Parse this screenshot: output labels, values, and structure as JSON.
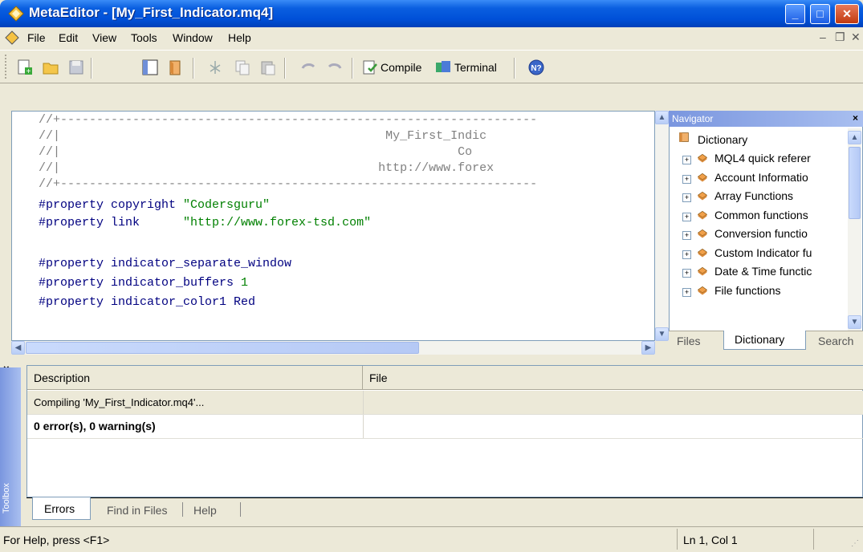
{
  "window": {
    "title": "MetaEditor - [My_First_Indicator.mq4]"
  },
  "menu": {
    "file": "File",
    "edit": "Edit",
    "view": "View",
    "tools": "Tools",
    "window": "Window",
    "help": "Help"
  },
  "toolbar": {
    "compile_label": "Compile",
    "terminal_label": "Terminal"
  },
  "editor": {
    "lines": [
      "//+------------------------------------------------------------------",
      "//|                                             My_First_Indic",
      "//|                                                       Co",
      "//|                                            http://www.forex",
      "//+------------------------------------------------------------------"
    ],
    "prop1_kw": "#property copyright ",
    "prop1_val": "\"Codersguru\"",
    "prop2_kw": "#property link      ",
    "prop2_val": "\"http://www.forex-tsd.com\"",
    "prop3": "#property indicator_separate_window",
    "prop4_kw": "#property indicator_buffers ",
    "prop4_val": "1",
    "prop5_kw": "#property indicator_color1 ",
    "prop5_val": "Red"
  },
  "navigator": {
    "title": "Navigator",
    "root": "Dictionary",
    "items": [
      "MQL4 quick referer",
      "Account Informatio",
      "Array Functions",
      "Common functions",
      "Conversion functio",
      "Custom Indicator fu",
      "Date & Time functic",
      "File functions"
    ],
    "tabs": [
      "Files",
      "Dictionary",
      "Search"
    ]
  },
  "toolbox": {
    "side_label": "Toolbox",
    "columns": [
      "Description",
      "File"
    ],
    "rows": [
      "Compiling 'My_First_Indicator.mq4'...",
      "0 error(s), 0 warning(s)"
    ],
    "tabs": [
      "Errors",
      "Find in Files",
      "Help"
    ]
  },
  "status": {
    "help": "For Help, press <F1>",
    "position": "Ln 1, Col 1"
  },
  "colors": {
    "title_blue": "#0050d8",
    "keyword": "#000080",
    "string": "#008000"
  }
}
